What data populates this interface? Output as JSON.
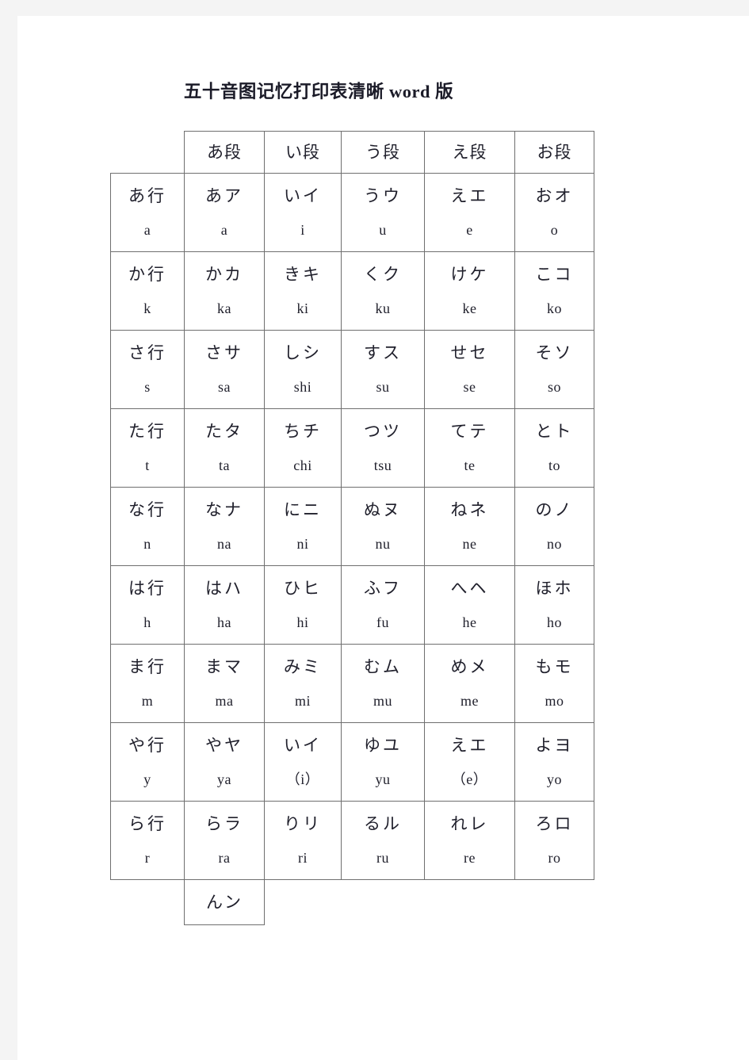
{
  "document": {
    "title": "五十音图记忆打印表清晰 word 版",
    "page_background": "#f4f4f4",
    "paper_color": "#ffffff",
    "border_color": "#6f6f6f",
    "text_color": "#20202c"
  },
  "table": {
    "corner_label": "",
    "column_headers": [
      "あ段",
      "い段",
      "う段",
      "え段",
      "お段"
    ],
    "rows": [
      {
        "row_header_kana": "あ行",
        "row_header_roma": "a",
        "cells": [
          {
            "kana": "あア",
            "roma": "a"
          },
          {
            "kana": "いイ",
            "roma": "i"
          },
          {
            "kana": "うウ",
            "roma": "u"
          },
          {
            "kana": "えエ",
            "roma": "e"
          },
          {
            "kana": "おオ",
            "roma": "o"
          }
        ]
      },
      {
        "row_header_kana": "か行",
        "row_header_roma": "k",
        "cells": [
          {
            "kana": "かカ",
            "roma": "ka"
          },
          {
            "kana": "きキ",
            "roma": "ki"
          },
          {
            "kana": "くク",
            "roma": "ku"
          },
          {
            "kana": "けケ",
            "roma": "ke"
          },
          {
            "kana": "こコ",
            "roma": "ko"
          }
        ]
      },
      {
        "row_header_kana": "さ行",
        "row_header_roma": "s",
        "cells": [
          {
            "kana": "さサ",
            "roma": "sa"
          },
          {
            "kana": "しシ",
            "roma": "shi"
          },
          {
            "kana": "すス",
            "roma": "su"
          },
          {
            "kana": "せセ",
            "roma": "se"
          },
          {
            "kana": "そソ",
            "roma": "so"
          }
        ]
      },
      {
        "row_header_kana": "た行",
        "row_header_roma": "t",
        "cells": [
          {
            "kana": "たタ",
            "roma": "ta"
          },
          {
            "kana": "ちチ",
            "roma": "chi"
          },
          {
            "kana": "つツ",
            "roma": "tsu"
          },
          {
            "kana": "てテ",
            "roma": "te"
          },
          {
            "kana": "とト",
            "roma": "to"
          }
        ]
      },
      {
        "row_header_kana": "な行",
        "row_header_roma": "n",
        "cells": [
          {
            "kana": "なナ",
            "roma": "na"
          },
          {
            "kana": "にニ",
            "roma": "ni"
          },
          {
            "kana": "ぬヌ",
            "roma": "nu"
          },
          {
            "kana": "ねネ",
            "roma": "ne"
          },
          {
            "kana": "のノ",
            "roma": "no"
          }
        ]
      },
      {
        "row_header_kana": "は行",
        "row_header_roma": "h",
        "cells": [
          {
            "kana": "はハ",
            "roma": "ha"
          },
          {
            "kana": "ひヒ",
            "roma": "hi"
          },
          {
            "kana": "ふフ",
            "roma": "fu"
          },
          {
            "kana": "へヘ",
            "roma": "he"
          },
          {
            "kana": "ほホ",
            "roma": "ho"
          }
        ]
      },
      {
        "row_header_kana": "ま行",
        "row_header_roma": "m",
        "cells": [
          {
            "kana": "まマ",
            "roma": "ma"
          },
          {
            "kana": "みミ",
            "roma": "mi"
          },
          {
            "kana": "むム",
            "roma": "mu"
          },
          {
            "kana": "めメ",
            "roma": "me"
          },
          {
            "kana": "もモ",
            "roma": "mo"
          }
        ]
      },
      {
        "row_header_kana": "や行",
        "row_header_roma": "y",
        "cells": [
          {
            "kana": "やヤ",
            "roma": "ya"
          },
          {
            "kana": "いイ",
            "roma": "（i）"
          },
          {
            "kana": "ゆユ",
            "roma": "yu"
          },
          {
            "kana": "えエ",
            "roma": "（e）"
          },
          {
            "kana": "よヨ",
            "roma": "yo"
          }
        ]
      },
      {
        "row_header_kana": "ら行",
        "row_header_roma": "r",
        "cells": [
          {
            "kana": "らラ",
            "roma": "ra"
          },
          {
            "kana": "りリ",
            "roma": "ri"
          },
          {
            "kana": "るル",
            "roma": "ru"
          },
          {
            "kana": "れレ",
            "roma": "re"
          },
          {
            "kana": "ろロ",
            "roma": "ro"
          }
        ]
      }
    ],
    "tail_row": {
      "kana": "んン",
      "roma": ""
    }
  }
}
